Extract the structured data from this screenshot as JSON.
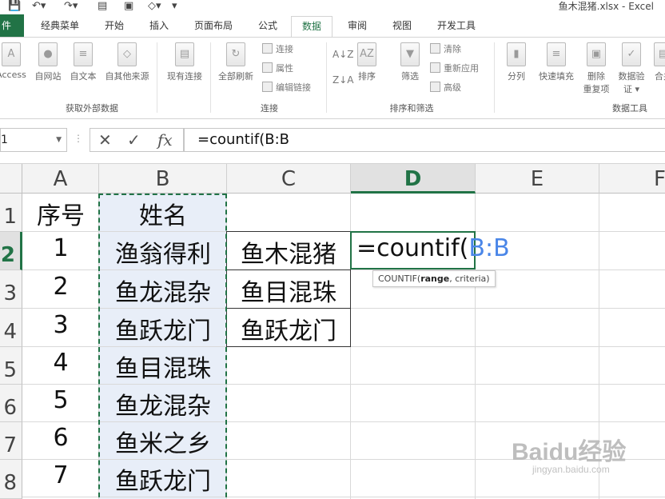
{
  "window": {
    "title": "鱼木混猪.xlsx - Excel"
  },
  "tabs": {
    "file": "件",
    "items": [
      "经典菜单",
      "开始",
      "插入",
      "页面布局",
      "公式",
      "数据",
      "审阅",
      "视图",
      "开发工具"
    ],
    "active": "数据"
  },
  "ribbon": {
    "get_external": {
      "buttons": [
        "Access",
        "自网站",
        "自文本",
        "自其他来源"
      ],
      "label": "获取外部数据"
    },
    "existing_conn": "现有连接",
    "connections": {
      "refresh_all": "全部刷新",
      "items": [
        "连接",
        "属性",
        "编辑链接"
      ],
      "label": "连接"
    },
    "sort_filter": {
      "sort": "排序",
      "filter": "筛选",
      "items": [
        "清除",
        "重新应用",
        "高级"
      ],
      "label": "排序和筛选"
    },
    "data_tools": {
      "split": "分列",
      "flash_fill": "快速填充",
      "remove_dup_1": "删除",
      "remove_dup_2": "重复项",
      "validation_1": "数据验",
      "validation_2": "证",
      "merge": "合并",
      "label": "数据工具"
    }
  },
  "formula_bar": {
    "name_box": "1",
    "fx": "fx",
    "formula": "=countif(B:B"
  },
  "sheet": {
    "columns": [
      "A",
      "B",
      "C",
      "D",
      "E",
      "F"
    ],
    "selected_column": "D",
    "row_numbers": [
      "1",
      "2",
      "3",
      "4",
      "5",
      "6",
      "7",
      "8"
    ],
    "selected_row": "2",
    "header_row": {
      "a": "序号",
      "b": "姓名"
    },
    "rows": [
      {
        "a": "1",
        "b": "渔翁得利",
        "c": "鱼木混猪"
      },
      {
        "a": "2",
        "b": "鱼龙混杂",
        "c": "鱼目混珠"
      },
      {
        "a": "3",
        "b": "鱼跃龙门",
        "c": "鱼跃龙门"
      },
      {
        "a": "4",
        "b": "鱼目混珠",
        "c": ""
      },
      {
        "a": "5",
        "b": "鱼龙混杂",
        "c": ""
      },
      {
        "a": "6",
        "b": "鱼米之乡",
        "c": ""
      },
      {
        "a": "7",
        "b": "鱼跃龙门",
        "c": ""
      }
    ],
    "editing_cell": {
      "prefix": "=countif(",
      "ref": "B:B"
    },
    "tooltip": {
      "func": "COUNTIF(",
      "arg1": "range",
      "rest": ", criteria)"
    }
  },
  "watermark": {
    "main": "Baidu经验",
    "sub": "jingyan.baidu.com"
  }
}
